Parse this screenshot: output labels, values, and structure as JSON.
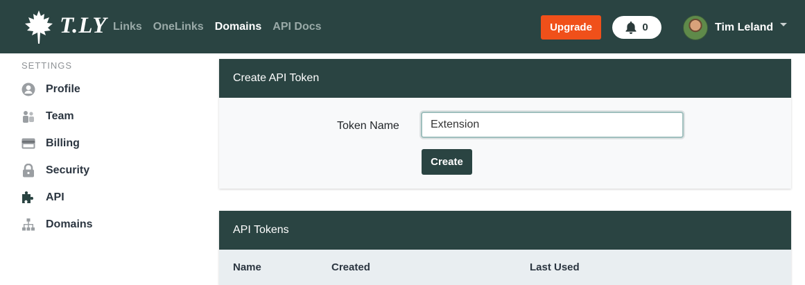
{
  "brand": {
    "name": "T.LY"
  },
  "nav": {
    "links": [
      {
        "label": "Links",
        "active": false
      },
      {
        "label": "OneLinks",
        "active": false
      },
      {
        "label": "Domains",
        "active": true
      },
      {
        "label": "API Docs",
        "active": false
      }
    ],
    "upgrade_label": "Upgrade",
    "notification_count": "0",
    "user_name": "Tim Leland"
  },
  "sidebar": {
    "heading": "SETTINGS",
    "items": [
      {
        "label": "Profile",
        "icon": "user-circle-icon",
        "active": false
      },
      {
        "label": "Team",
        "icon": "users-icon",
        "active": false
      },
      {
        "label": "Billing",
        "icon": "credit-card-icon",
        "active": false
      },
      {
        "label": "Security",
        "icon": "lock-icon",
        "active": false
      },
      {
        "label": "API",
        "icon": "puzzle-icon",
        "active": true
      },
      {
        "label": "Domains",
        "icon": "sitemap-icon",
        "active": false
      }
    ]
  },
  "create_token": {
    "title": "Create API Token",
    "field_label": "Token Name",
    "field_value": "Extension",
    "button_label": "Create"
  },
  "tokens": {
    "title": "API Tokens",
    "columns": [
      "Name",
      "Created",
      "Last Used"
    ]
  },
  "colors": {
    "navbar": "#2a4442",
    "upgrade": "#f0501a",
    "table_header": "#e9eef1"
  }
}
